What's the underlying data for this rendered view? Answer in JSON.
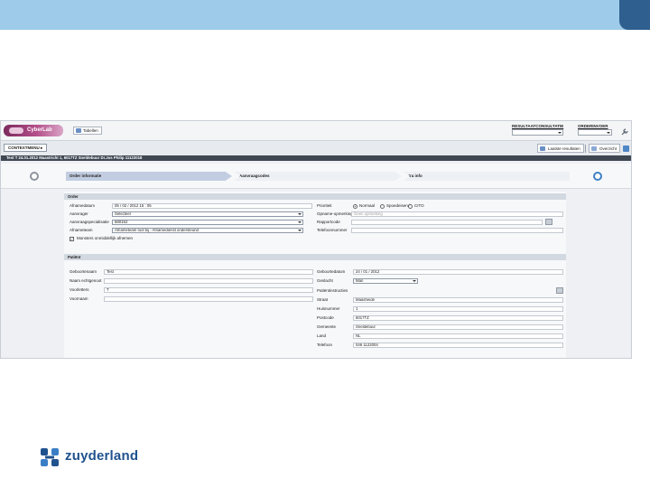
{
  "slide": {
    "colors": {
      "band": "#9ecbe9",
      "corner": "#2f5f8f",
      "brand": "#20528e"
    },
    "brand_name": "zuyderland"
  },
  "app": {
    "logo_text": "CyberLab",
    "tab_button": "Tabellen",
    "top_right": {
      "results_label": "RESULTAATCONSULTATIE",
      "order_label": "ORDERINVOER"
    },
    "toolbar": {
      "context_button": "CONTEXTMENU",
      "last_results_button": "Laatste resultaten",
      "overview_button": "Overzicht"
    },
    "context_line": "Test T 24.01.2012  Maastricht 1, 6017TZ Sneldebuur  Dr.Jos Philip 11122018",
    "wizard": {
      "steps": [
        "Order informatie",
        "Aanvraagcodes",
        "Extra info"
      ]
    },
    "form": {
      "order_section": "Order",
      "patient_section": "Patiënt",
      "labels": {
        "afname_datum": "Afnamedatum",
        "aanvrager": "Aanvrager",
        "aanvraagspecialisatie": "Aanvraagspecialisatie",
        "afnameteam": "Afnameteam",
        "afname_checkbox": "Monsters onmiddellijk afnemen",
        "prioriteit": "Prioriteit",
        "opmerkingen": "Opname-opmerking",
        "rapportcode": "Rapportcode",
        "telefoonnummer": "Telefoonnummer",
        "achternaam": "Geboortenaam",
        "partnernaam": "Naam echtgenoot",
        "voorletters": "Voorletters",
        "voornaam": "Voornaam",
        "geboortedatum": "Geboortedatum",
        "geslacht": "Geslacht",
        "patient_instructie": "Patiëntinstructies",
        "straat": "Straat",
        "huisnummer": "Huisnummer",
        "postcode": "Postcode",
        "gemeente": "Gemeente",
        "land": "Land",
        "telefoon": "Telefoon"
      },
      "values": {
        "afname_datum": "05 / 02 / 2012   15 : 05",
        "aanvrager": "Selecteer",
        "aanvraagspecialisatie": "580152",
        "afnameteam": "Afnameteam tool bij - Afnamedienst ondersteund",
        "radio_options": [
          "Normaal",
          "Spoedeisend",
          "CITO"
        ],
        "opmerkingen": "Geen opmerking",
        "achternaam": "Test",
        "voorletters": "T",
        "geboortedatum": "24 / 01 / 2012",
        "geslacht": "Man",
        "straat": "Maasheide",
        "huisnummer": "1",
        "postcode": "6017TZ",
        "gemeente": "Sneldebuur",
        "land": "NL",
        "telefoon": "046 1122004"
      }
    }
  }
}
